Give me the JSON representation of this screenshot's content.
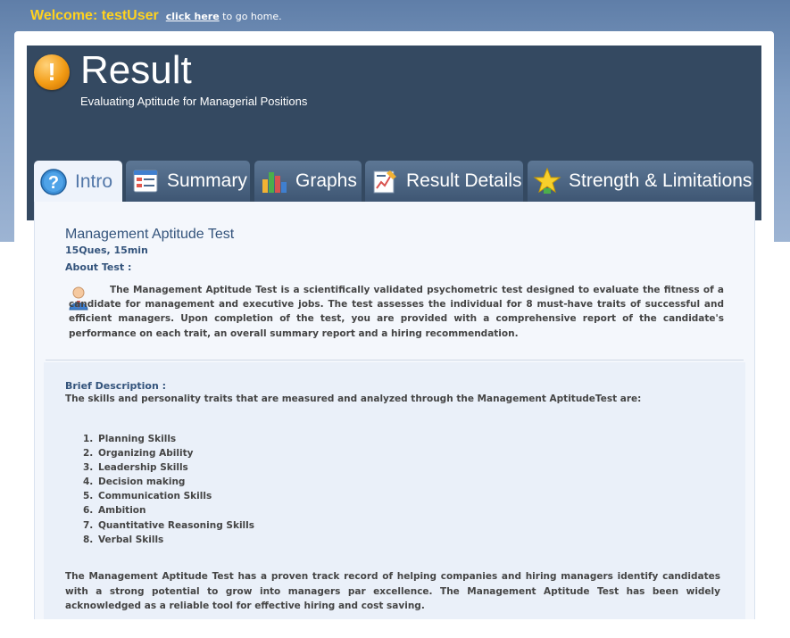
{
  "top_bar": {
    "welcome": "Welcome: testUser",
    "home_link": "click here",
    "home_suffix": " to go home."
  },
  "header": {
    "icon": "alert-icon",
    "title": "Result",
    "subtitle": "Evaluating Aptitude for Managerial Positions"
  },
  "tabs": [
    {
      "label": "Intro",
      "icon": "help-icon",
      "active": true
    },
    {
      "label": "Summary",
      "icon": "summary-list-icon",
      "active": false
    },
    {
      "label": "Graphs",
      "icon": "bar-chart-icon",
      "active": false
    },
    {
      "label": "Result Details",
      "icon": "details-chart-icon",
      "active": false
    },
    {
      "label": "Strength & Limitations",
      "icon": "star-icon",
      "active": false
    }
  ],
  "intro": {
    "test_title": "Management Aptitude Test",
    "test_meta": "15Ques, 15min",
    "about_label": "About Test :",
    "about_text": "The Management Aptitude Test is a scientifically validated psychometric test designed to evaluate the fitness of a candidate for management and executive jobs. The test assesses the individual for 8 must-have traits of successful and efficient managers. Upon completion of the test, you are provided with a comprehensive report of the candidate's performance on each trait, an overall summary report and a hiring recommendation.",
    "brief_label": "Brief Description :",
    "brief_intro": "The skills and personality traits that are measured and analyzed through the Management AptitudeTest are:",
    "skills": [
      {
        "num": "1.",
        "name": "Planning Skills"
      },
      {
        "num": "2.",
        "name": "Organizing Ability"
      },
      {
        "num": "3.",
        "name": "Leadership Skills"
      },
      {
        "num": "4.",
        "name": "Decision making"
      },
      {
        "num": "5.",
        "name": "Communication Skills"
      },
      {
        "num": "6.",
        "name": "Ambition"
      },
      {
        "num": "7.",
        "name": "Quantitative Reasoning Skills"
      },
      {
        "num": "8.",
        "name": "Verbal Skills"
      }
    ],
    "closing_text": "The Management Aptitude Test has a proven track record of helping companies and hiring managers identify candidates with a strong potential to grow into managers par excellence. The Management Aptitude Test has been widely acknowledged as a reliable tool for effective hiring and cost saving."
  }
}
